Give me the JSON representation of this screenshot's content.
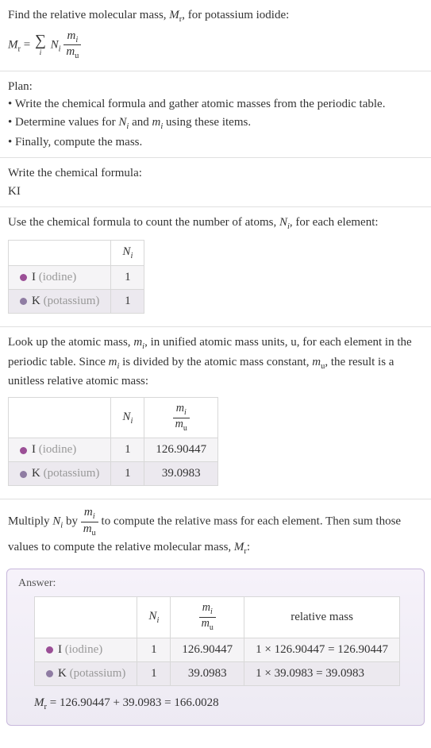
{
  "intro": {
    "line1_a": "Find the relative molecular mass, ",
    "line1_b": ", for potassium iodide:",
    "Mr": "M",
    "r_sub": "r",
    "equals": " = ",
    "sum_under": "i",
    "Ni": "N",
    "i_sub": "i",
    "frac_num_m": "m",
    "frac_den_m": "m",
    "u_sub": "u"
  },
  "plan": {
    "title": "Plan:",
    "items": [
      "Write the chemical formula and gather atomic masses from the periodic table.",
      "Determine values for N_i and m_i using these items.",
      "Finally, compute the mass."
    ],
    "item1": "Write the chemical formula and gather atomic masses from the periodic table.",
    "item2a": "Determine values for ",
    "item2b": " and ",
    "item2c": " using these items.",
    "item3": "Finally, compute the mass."
  },
  "formula_sec": {
    "title": "Write the chemical formula:",
    "formula": "KI"
  },
  "count_sec": {
    "text_a": "Use the chemical formula to count the number of atoms, ",
    "text_b": ", for each element:",
    "header_Ni": "N",
    "row_i_elem": "I ",
    "row_i_paren": "(iodine)",
    "row_i_val": "1",
    "row_k_elem": "K ",
    "row_k_paren": "(potassium)",
    "row_k_val": "1"
  },
  "mass_sec": {
    "text_a": "Look up the atomic mass, ",
    "text_b": ", in unified atomic mass units, u, for each element in the periodic table. Since ",
    "text_c": " is divided by the atomic mass constant, ",
    "text_d": ", the result is a unitless relative atomic mass:",
    "i_mass": "126.90447",
    "k_mass": "39.0983"
  },
  "multiply_sec": {
    "text_a": "Multiply ",
    "text_b": " by ",
    "text_c": " to compute the relative mass for each element. Then sum those values to compute the relative molecular mass, ",
    "text_d": ":"
  },
  "answer": {
    "label": "Answer:",
    "rel_mass_header": "relative mass",
    "i_rel": "1 × 126.90447 = 126.90447",
    "k_rel": "1 × 39.0983 = 39.0983",
    "final_a": " = 126.90447 + 39.0983 = 166.0028"
  }
}
